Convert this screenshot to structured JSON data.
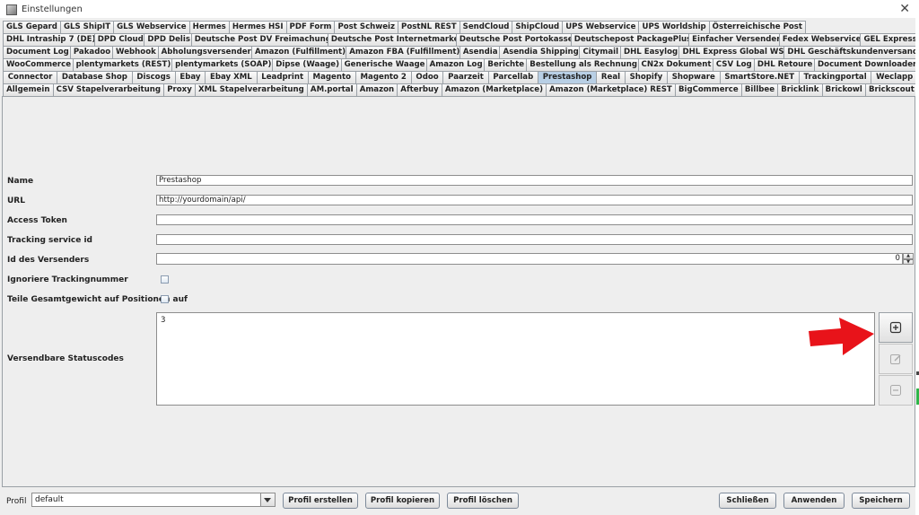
{
  "window": {
    "title": "Einstellungen"
  },
  "tabs": {
    "row1": [
      "GLS Gepard",
      "GLS ShipIT",
      "GLS Webservice",
      "Hermes",
      "Hermes HSI",
      "PDF Form",
      "Post Schweiz",
      "PostNL REST",
      "SendCloud",
      "ShipCloud",
      "UPS Webservice",
      "UPS Worldship",
      "Österreichische Post"
    ],
    "row2": [
      "DHL Intraship 7 (DE)",
      "DPD Cloud",
      "DPD Delis",
      "Deutsche Post DV Freimachung",
      "Deutsche Post Internetmarke",
      "Deutsche Post Portokasse",
      "Deutschepost PackagePlus",
      "Einfacher Versender",
      "Fedex Webservice",
      "GEL Express"
    ],
    "row3": [
      "Document Log",
      "Pakadoo",
      "Webhook",
      "Abholungsversender",
      "Amazon (Fulfillment)",
      "Amazon FBA (Fulfillment)",
      "Asendia",
      "Asendia Shipping",
      "Citymail",
      "DHL Easylog",
      "DHL Express Global WS",
      "DHL Geschäftskundenversand"
    ],
    "row4": [
      "WooCommerce",
      "plentymarkets (REST)",
      "plentymarkets (SOAP)",
      "Dipse (Waage)",
      "Generische Waage",
      "Amazon Log",
      "Berichte",
      "Bestellung als Rechnung",
      "CN2x Dokument",
      "CSV Log",
      "DHL Retoure",
      "Document Downloader"
    ],
    "row5": [
      "Connector",
      "Database Shop",
      "Discogs",
      "Ebay",
      "Ebay XML",
      "Leadprint",
      "Magento",
      "Magento 2",
      "Odoo",
      "Paarzeit",
      "Parcellab",
      "Prestashop",
      "Real",
      "Shopify",
      "Shopware",
      "SmartStore.NET",
      "Trackingportal",
      "Weclapp"
    ],
    "row6": [
      "Allgemein",
      "CSV Stapelverarbeitung",
      "Proxy",
      "XML Stapelverarbeitung",
      "AM.portal",
      "Amazon",
      "Afterbuy",
      "Amazon (Marketplace)",
      "Amazon (Marketplace) REST",
      "BigCommerce",
      "Billbee",
      "Bricklink",
      "Brickowl",
      "Brickscout"
    ],
    "active": "Prestashop"
  },
  "form": {
    "name_label": "Name",
    "name_value": "Prestashop",
    "url_label": "URL",
    "url_value": "http://yourdomain/api/",
    "access_token_label": "Access Token",
    "access_token_value": "",
    "tracking_service_label": "Tracking service id",
    "tracking_service_value": "",
    "sender_id_label": "Id des Versenders",
    "sender_id_value": "0",
    "ignore_tracking_label": "Ignoriere Trackingnummer",
    "split_weight_label": "Teile Gesamtgewicht auf Positionen auf",
    "status_codes_label": "Versendbare Statuscodes",
    "status_codes_value": "3"
  },
  "bottom": {
    "profile_label": "Profil",
    "profile_value": "default",
    "create_label": "Profil erstellen",
    "copy_label": "Profil kopieren",
    "delete_label": "Profil löschen",
    "close_label": "Schließen",
    "apply_label": "Anwenden",
    "save_label": "Speichern"
  },
  "colors": {
    "active_tab": "#b8cfe5",
    "arrow": "#e8131a"
  },
  "icons": {
    "close": "close-icon",
    "add": "plus-square-icon",
    "edit": "edit-icon",
    "remove": "minus-square-icon"
  }
}
